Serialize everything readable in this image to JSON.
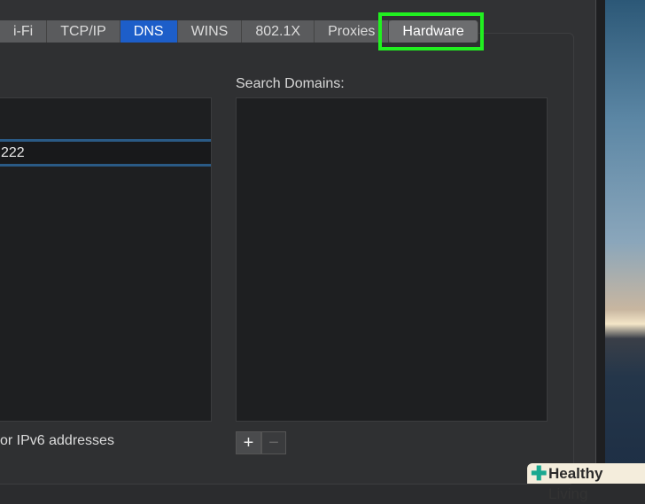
{
  "tabs": [
    "i-Fi",
    "TCP/IP",
    "DNS",
    "WINS",
    "802.1X",
    "Proxies",
    "Hardware"
  ],
  "active_tab": "DNS",
  "search_domains_label": "Search Domains:",
  "dns_servers": {
    "selected_entry": "222"
  },
  "hint_text": "or IPv6 addresses",
  "buttons": {
    "add": "+",
    "remove": "−"
  },
  "watermark": {
    "bold": "Healthy",
    "light": "Living"
  },
  "colors": {
    "highlight": "#21f020",
    "active_tab": "#1d5ec9"
  }
}
